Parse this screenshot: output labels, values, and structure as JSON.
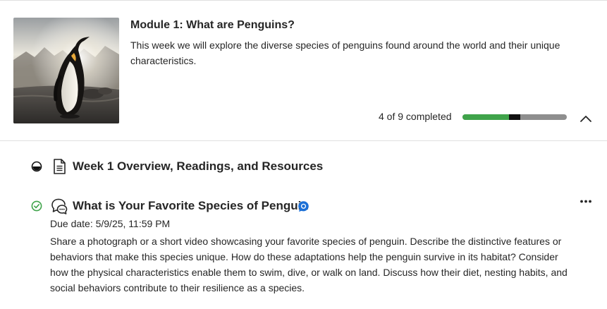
{
  "module": {
    "title": "Module 1: What are Penguins?",
    "description": "This week we will explore the diverse species of penguins found around the world and their unique characteristics.",
    "progress_text": "4 of 9 completed",
    "progress_completed": 4,
    "progress_total": 9,
    "image": "penguin-photo",
    "collapse_icon": "chevron-up-icon"
  },
  "items": [
    {
      "title": "Week 1 Overview, Readings, and Resources",
      "status_icon": "partial-progress-icon",
      "type_icon": "document-icon"
    },
    {
      "title": "What is Your Favorite Species of Penguin",
      "status_icon": "completed-check-icon",
      "type_icon": "discussion-icon",
      "badge_icon": "new-activity-icon",
      "due_date": "Due date: 5/9/25, 11:59 PM",
      "description": "Share a photograph or a short video showcasing your favorite species of penguin. Describe the distinctive features or behaviors that make this species unique. How do these adaptations help the penguin survive in its habitat? Consider how the physical characteristics enable them to swim, dive, or walk on land. Discuss how their diet, nesting habits, and social behaviors contribute to their resilience as a species.",
      "more_icon": "more-options-icon"
    }
  ],
  "colors": {
    "progress_complete": "#3fa34a",
    "progress_current": "#111111",
    "progress_remaining": "#8e8e8e",
    "check_green": "#3fa34a",
    "badge_blue": "#1b6fd6",
    "divider": "#e0e0e0"
  }
}
